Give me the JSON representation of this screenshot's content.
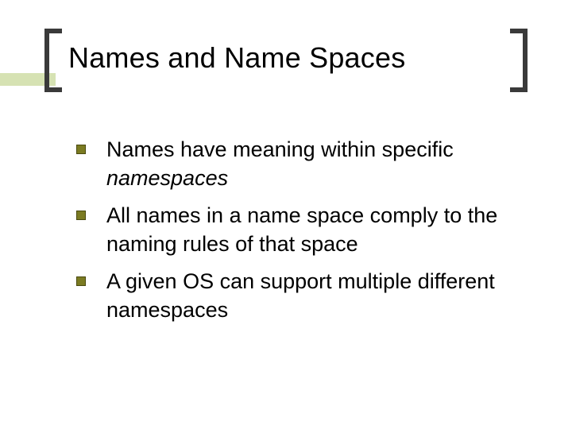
{
  "title": "Names and Name Spaces",
  "bullets": [
    {
      "plain": "Names have meaning within specific ",
      "italic": "namespaces"
    },
    {
      "plain": "All names in a name space comply to the naming rules of that space",
      "italic": ""
    },
    {
      "plain": "A given OS can support multiple different namespaces",
      "italic": ""
    }
  ]
}
